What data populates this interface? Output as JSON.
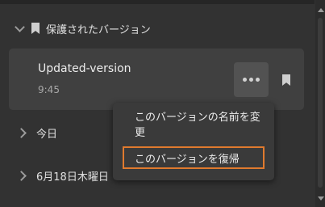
{
  "saved_versions": {
    "header_label": "保護されたバージョン",
    "card": {
      "name": "Updated-version",
      "time": "9:45"
    }
  },
  "groups": [
    {
      "label": "今日"
    },
    {
      "label": "6月18日木曜日"
    }
  ],
  "context_menu": {
    "items": [
      {
        "label": "このバージョンの名前を変更"
      },
      {
        "label": "このバージョンを復帰"
      }
    ]
  },
  "colors": {
    "background": "#323232",
    "card": "#404040",
    "focus_outline": "#e07a2e"
  },
  "icons": {
    "expand": "chevron-down-icon",
    "collapse": "chevron-right-icon",
    "bookmark": "bookmark-icon",
    "more": "more-horizontal-icon"
  }
}
